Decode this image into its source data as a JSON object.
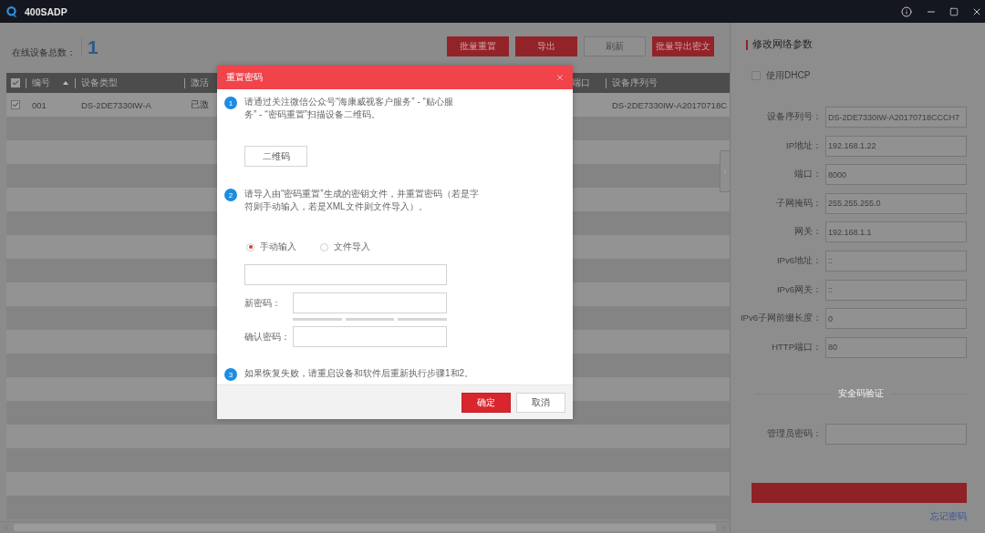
{
  "window": {
    "title": "400SADP"
  },
  "toolbar": {
    "online_label": "在线设备总数：",
    "online_count": "1",
    "buttons": [
      {
        "label": "批量重置",
        "kind": "primary"
      },
      {
        "label": "导出",
        "kind": "primary"
      },
      {
        "label": "刷新",
        "kind": "plain"
      },
      {
        "label": "批量导出密文",
        "kind": "primary"
      }
    ]
  },
  "table": {
    "header_checked": true,
    "columns": [
      {
        "label": "编号",
        "sorted": true
      },
      {
        "label": "设备类型",
        "sorted": false
      },
      {
        "label": "激活",
        "sorted": false
      },
      {
        "label": "端口",
        "sorted": false
      },
      {
        "label": "设备序列号",
        "sorted": false
      }
    ],
    "rows": [
      {
        "checked": true,
        "cells": [
          "001",
          "DS-2DE7330IW-A",
          "已激",
          null,
          "DS-2DE7330IW-A20170718C"
        ]
      }
    ]
  },
  "dialog": {
    "title": "重置密码",
    "steps": [
      {
        "number": "1",
        "text": "请通过关注微信公众号“海康威视客户服务” - “贴心服务” - “密码重置”扫描设备二维码。"
      },
      {
        "number": "2",
        "text": "请导入由“密码重置”生成的密钥文件，并重置密码（若是字符则手动输入，若是XML文件则文件导入）。"
      },
      {
        "number": "3",
        "text": "如果恢复失败，请重启设备和软件后重新执行步骤1和2。"
      }
    ],
    "qr_button": "二维码",
    "import_modes": [
      {
        "label": "手动输入",
        "selected": true
      },
      {
        "label": "文件导入",
        "selected": false
      }
    ],
    "password_fields": [
      {
        "label": "新密码："
      },
      {
        "label": "确认密码："
      }
    ],
    "buttons": [
      {
        "label": "确定",
        "kind": "primary"
      },
      {
        "label": "取消",
        "kind": "plain"
      }
    ]
  },
  "network_panel": {
    "title": "修改网络参数",
    "dhcp": {
      "label": "使用DHCP",
      "checked": false
    },
    "fields": [
      {
        "label": "设备序列号：",
        "value": "DS-2DE7330IW-A20170718CCCH7"
      },
      {
        "label": "IP地址：",
        "value": "192.168.1.22"
      },
      {
        "label": "端口：",
        "value": "8000"
      },
      {
        "label": "子网掩码：",
        "value": "255.255.255.0"
      },
      {
        "label": "网关：",
        "value": "192.168.1.1"
      },
      {
        "label": "IPv6地址：",
        "value": "::"
      },
      {
        "label": "IPv6网关：",
        "value": "::"
      },
      {
        "label": "IPv6子网前缀长度：",
        "value": "0"
      },
      {
        "label": "HTTP端口：",
        "value": "80"
      }
    ],
    "security_section": "安全码验证",
    "admin_password": {
      "label": "管理员密码："
    },
    "forgot_link": "忘记密码"
  }
}
